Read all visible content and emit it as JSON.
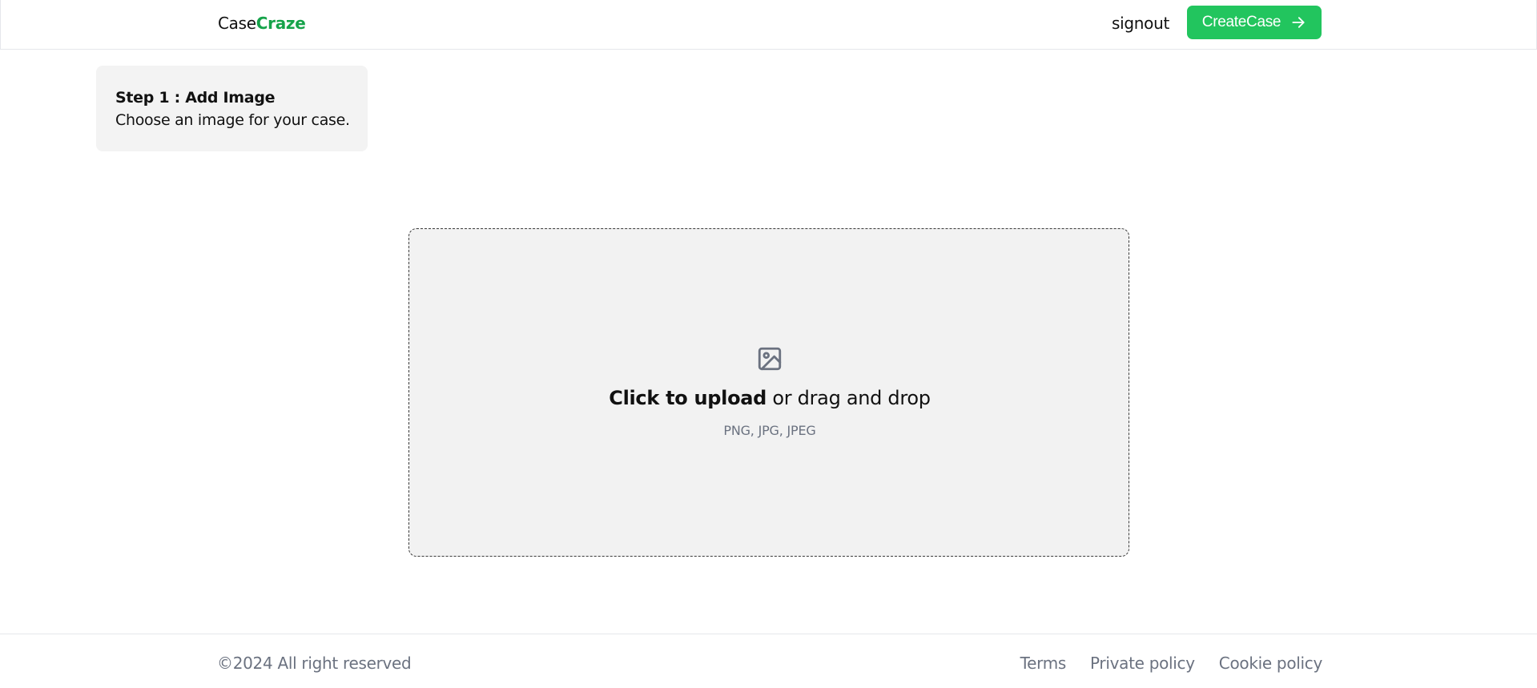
{
  "header": {
    "logo_prefix": "Case",
    "logo_accent": "Craze",
    "signout_label": "signout",
    "create_label": "CreateCase",
    "create_icon": "arrow-right-icon"
  },
  "step": {
    "title": "Step 1 : Add Image",
    "description": "Choose an image for your case."
  },
  "dropzone": {
    "icon": "image-icon",
    "cta_strong": "Click to upload",
    "cta_rest": " or drag and drop",
    "formats": "PNG, JPG, JPEG"
  },
  "footer": {
    "copyright": "©2024 All right reserved",
    "links": [
      {
        "label": "Terms"
      },
      {
        "label": "Private policy"
      },
      {
        "label": "Cookie policy"
      }
    ]
  },
  "colors": {
    "accent_text": "#16a34a",
    "accent_button": "#22c55e",
    "muted_text": "#6b7280",
    "card_bg": "#f3f3f3"
  }
}
